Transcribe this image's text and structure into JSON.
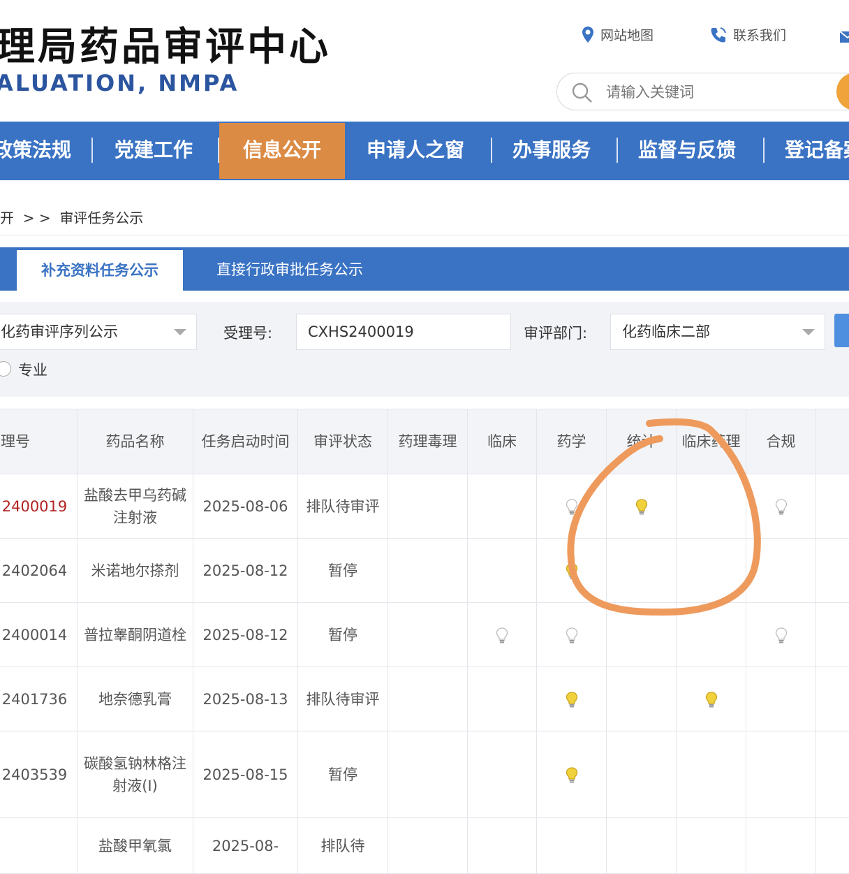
{
  "header": {
    "title_cn": "理局药品审评中心",
    "title_en": "ALUATION, NMPA",
    "links": {
      "sitemap": "网站地图",
      "contact": "联系我们"
    },
    "search": {
      "placeholder": "请输入关键词",
      "value": ""
    }
  },
  "nav": {
    "items": [
      {
        "label": "政策法规",
        "active": false
      },
      {
        "label": "党建工作",
        "active": false
      },
      {
        "label": "信息公开",
        "active": true
      },
      {
        "label": "申请人之窗",
        "active": false
      },
      {
        "label": "办事服务",
        "active": false
      },
      {
        "label": "监督与反馈",
        "active": false
      },
      {
        "label": "登记备案",
        "active": false
      }
    ]
  },
  "breadcrumb": {
    "parent": "开",
    "separator": "> >",
    "current": "审评任务公示"
  },
  "tabs": [
    {
      "label": "补充资料任务公示",
      "active": true
    },
    {
      "label": "直接行政审批任务公示",
      "active": false
    }
  ],
  "filters": {
    "sequence_select": "化药审评序列公示",
    "accept_no_label": "受理号:",
    "accept_no_value": "CXHS2400019",
    "dept_label": "审评部门:",
    "dept_select": "化药临床二部",
    "radio_label": "专业"
  },
  "table": {
    "headers": {
      "code": "理号",
      "name": "药品名称",
      "start": "任务启动时间",
      "status": "审评状态",
      "tox": "药理毒理",
      "clinical": "临床",
      "pharma": "药学",
      "stat": "统计",
      "clinpharm": "临床药理",
      "compliance": "合规"
    },
    "rows": [
      {
        "code": "2400019",
        "name": "盐酸去甲乌药碱注射液",
        "date": "2025-08-06",
        "status": "排队待审评",
        "code_highlight": true,
        "bulbs": {
          "tox": "",
          "clinical": "",
          "pharma": "off",
          "stat": "on",
          "clinpharm": "",
          "compliance": "off"
        }
      },
      {
        "code": "2402064",
        "name": "米诺地尔搽剂",
        "date": "2025-08-12",
        "status": "暂停",
        "code_highlight": false,
        "bulbs": {
          "tox": "",
          "clinical": "",
          "pharma": "on",
          "stat": "",
          "clinpharm": "",
          "compliance": ""
        }
      },
      {
        "code": "2400014",
        "name": "普拉睾酮阴道栓",
        "date": "2025-08-12",
        "status": "暂停",
        "code_highlight": false,
        "bulbs": {
          "tox": "",
          "clinical": "off",
          "pharma": "off",
          "stat": "",
          "clinpharm": "",
          "compliance": "off"
        }
      },
      {
        "code": "2401736",
        "name": "地奈德乳膏",
        "date": "2025-08-13",
        "status": "排队待审评",
        "code_highlight": false,
        "bulbs": {
          "tox": "",
          "clinical": "",
          "pharma": "on",
          "stat": "",
          "clinpharm": "on",
          "compliance": ""
        }
      },
      {
        "code": "2403539",
        "name": "碳酸氢钠林格注射液(Ⅰ)",
        "date": "2025-08-15",
        "status": "暂停",
        "code_highlight": false,
        "bulbs": {
          "tox": "",
          "clinical": "",
          "pharma": "on",
          "stat": "",
          "clinpharm": "",
          "compliance": ""
        }
      },
      {
        "code": "",
        "name": "盐酸甲氧氯",
        "date": "2025-08-",
        "status": "排队待",
        "code_highlight": false,
        "bulbs": {
          "tox": "",
          "clinical": "",
          "pharma": "",
          "stat": "",
          "clinpharm": "",
          "compliance": ""
        }
      }
    ]
  },
  "colors": {
    "nav_blue": "#3a73c4",
    "nav_active": "#dc8b45",
    "annotation": "#ee9a5c",
    "bulb_on": "#f2d23c",
    "bulb_off": "#d8d8d8"
  }
}
